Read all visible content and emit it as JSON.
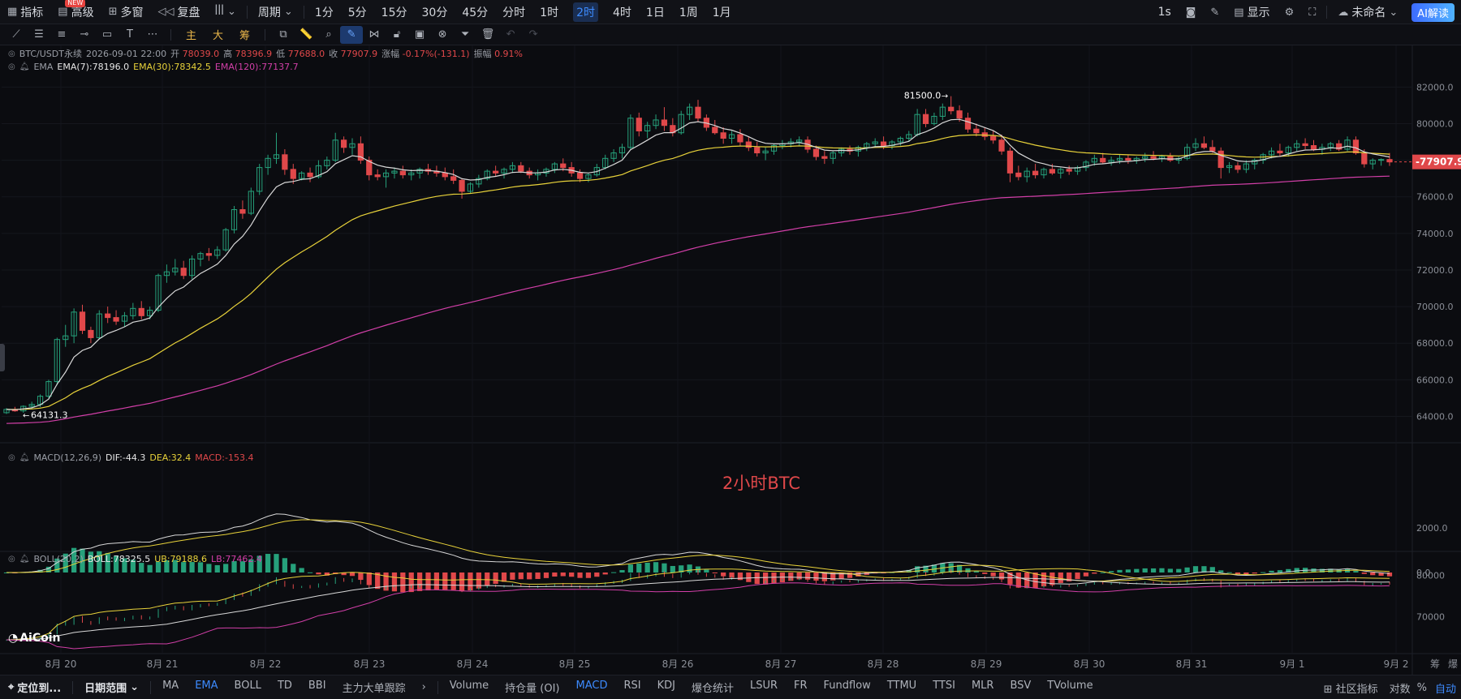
{
  "toolbar": {
    "indicators": "指标",
    "new_badge": "NEW",
    "advanced": "高级",
    "multi_window": "多窗",
    "replay": "复盘",
    "period_label": "周期",
    "intervals": [
      "1分",
      "5分",
      "15分",
      "30分",
      "45分",
      "分时",
      "1时",
      "2时",
      "4时",
      "1日",
      "1周",
      "1月"
    ],
    "active_interval": "2时",
    "refresh": "1s",
    "display": "显示",
    "unnamed": "未命名",
    "ai_read": "AI解读"
  },
  "drawbar": {
    "main": "主",
    "large": "大",
    "chips": "筹"
  },
  "legend": {
    "symbol": "BTC/USDT永续",
    "datetime": "2026-09-01 22:00",
    "open_label": "开",
    "open": "78039.0",
    "high_label": "高",
    "high": "78396.9",
    "low_label": "低",
    "low": "77688.0",
    "close_label": "收",
    "close": "77907.9",
    "change_label": "涨幅",
    "change": "-0.17%(-131.1)",
    "amplitude_label": "振幅",
    "amplitude": "0.91%",
    "ema_name": "EMA",
    "ema7": "EMA(7):78196.0",
    "ema30": "EMA(30):78342.5",
    "ema120": "EMA(120):77137.7",
    "macd_name": "MACD(12,26,9)",
    "dif": "DIF:-44.3",
    "dea": "DEA:32.4",
    "macd": "MACD:-153.4",
    "boll_name": "BOLL(20,2)",
    "boll": "BOLL:78325.5",
    "ub": "UB:79188.6",
    "lb": "LB:77462.4"
  },
  "annotation": "2小时BTC",
  "logo": "AiCoin",
  "colors": {
    "up": "#26a17b",
    "down": "#e0484a",
    "ema7": "#d8d8d8",
    "ema30": "#e8d23a",
    "ema120": "#d23fa8",
    "price_tag": "#e0484a",
    "accent": "#3d8bff"
  },
  "chart_data": {
    "type": "candlestick",
    "symbol": "BTC/USDT永续",
    "interval": "2时",
    "x_ticks": [
      "8月 20",
      "8月 21",
      "8月 22",
      "8月 23",
      "8月 24",
      "8月 25",
      "8月 26",
      "8月 27",
      "8月 28",
      "8月 29",
      "8月 30",
      "8月 31",
      "9月 1",
      "9月 2"
    ],
    "price_axis": {
      "ticks": [
        82000,
        80000,
        78000,
        76000,
        74000,
        72000,
        70000,
        68000,
        66000,
        64000
      ],
      "ylim": [
        63000,
        83300
      ]
    },
    "last_price": 77907.9,
    "high_marker": 81500.0,
    "low_marker": 64131.3,
    "candles_ohlc": [
      [
        64200,
        64450,
        64131.3,
        64380
      ],
      [
        64380,
        64520,
        64250,
        64300
      ],
      [
        64300,
        64600,
        64200,
        64550
      ],
      [
        64550,
        64800,
        64400,
        64650
      ],
      [
        64650,
        65200,
        64500,
        65100
      ],
      [
        65100,
        66000,
        65000,
        65900
      ],
      [
        65900,
        68300,
        65700,
        68200
      ],
      [
        68200,
        69000,
        67800,
        68400
      ],
      [
        68400,
        69900,
        68000,
        69700
      ],
      [
        69700,
        70100,
        68500,
        68700
      ],
      [
        68700,
        68900,
        68000,
        68300
      ],
      [
        68300,
        69800,
        68200,
        69600
      ],
      [
        69600,
        70000,
        69100,
        69400
      ],
      [
        69400,
        69800,
        69000,
        69200
      ],
      [
        69200,
        69700,
        68900,
        69500
      ],
      [
        69500,
        70200,
        69300,
        69900
      ],
      [
        69900,
        70300,
        69300,
        69500
      ],
      [
        69500,
        70000,
        69300,
        69800
      ],
      [
        69800,
        71800,
        69700,
        71700
      ],
      [
        71700,
        72300,
        71300,
        71900
      ],
      [
        71900,
        72600,
        71700,
        72100
      ],
      [
        72100,
        72500,
        71500,
        71700
      ],
      [
        71700,
        72800,
        71500,
        72600
      ],
      [
        72600,
        73000,
        72200,
        72900
      ],
      [
        72900,
        73200,
        72500,
        72800
      ],
      [
        72800,
        73300,
        72600,
        73100
      ],
      [
        73100,
        74300,
        73000,
        74200
      ],
      [
        74200,
        75500,
        74000,
        75300
      ],
      [
        75300,
        75800,
        74800,
        75100
      ],
      [
        75100,
        76500,
        75000,
        76300
      ],
      [
        76300,
        77800,
        76100,
        77600
      ],
      [
        77600,
        78300,
        77200,
        78100
      ],
      [
        78100,
        79500,
        77800,
        78300
      ],
      [
        78300,
        78600,
        77200,
        77500
      ],
      [
        77500,
        77800,
        76700,
        77000
      ],
      [
        77000,
        77400,
        76900,
        77300
      ],
      [
        77300,
        77600,
        76800,
        77100
      ],
      [
        77100,
        78000,
        77000,
        77700
      ],
      [
        77700,
        78200,
        77500,
        78000
      ],
      [
        78000,
        79500,
        77900,
        79100
      ],
      [
        79100,
        79300,
        78400,
        78700
      ],
      [
        78700,
        79200,
        78300,
        78900
      ],
      [
        78900,
        79300,
        77800,
        78000
      ],
      [
        78000,
        78200,
        76900,
        77200
      ],
      [
        77200,
        77500,
        76900,
        77100
      ],
      [
        77100,
        77500,
        76500,
        77300
      ],
      [
        77300,
        77600,
        77000,
        77400
      ],
      [
        77400,
        77700,
        77000,
        77200
      ],
      [
        77200,
        77500,
        76900,
        77300
      ],
      [
        77300,
        77600,
        77000,
        77500
      ],
      [
        77500,
        77800,
        77200,
        77400
      ],
      [
        77400,
        77700,
        77100,
        77300
      ],
      [
        77300,
        77600,
        76900,
        77100
      ],
      [
        77100,
        77500,
        76700,
        76900
      ],
      [
        76900,
        77000,
        75900,
        76300
      ],
      [
        76300,
        76800,
        76200,
        76700
      ],
      [
        76700,
        77200,
        76500,
        77000
      ],
      [
        77000,
        77500,
        76900,
        77400
      ],
      [
        77400,
        77700,
        77100,
        77300
      ],
      [
        77300,
        77600,
        77000,
        77500
      ],
      [
        77500,
        77900,
        77300,
        77700
      ],
      [
        77700,
        77900,
        77300,
        77400
      ],
      [
        77400,
        77600,
        77000,
        77200
      ],
      [
        77200,
        77500,
        76900,
        77300
      ],
      [
        77300,
        77600,
        77100,
        77500
      ],
      [
        77500,
        77900,
        77300,
        77800
      ],
      [
        77800,
        78100,
        77400,
        77600
      ],
      [
        77600,
        77900,
        77100,
        77300
      ],
      [
        77300,
        77500,
        76800,
        77000
      ],
      [
        77000,
        77300,
        76800,
        77200
      ],
      [
        77200,
        77800,
        77100,
        77600
      ],
      [
        77600,
        78300,
        77500,
        78100
      ],
      [
        78100,
        78600,
        77900,
        78400
      ],
      [
        78400,
        78900,
        78100,
        78700
      ],
      [
        78700,
        80500,
        78600,
        80300
      ],
      [
        80300,
        80600,
        79300,
        79600
      ],
      [
        79600,
        80100,
        79200,
        79900
      ],
      [
        79900,
        80500,
        79700,
        80200
      ],
      [
        80200,
        80900,
        79600,
        79900
      ],
      [
        79900,
        80300,
        79300,
        79500
      ],
      [
        79500,
        80700,
        79400,
        80500
      ],
      [
        80500,
        81100,
        80200,
        80900
      ],
      [
        80900,
        81300,
        80100,
        80300
      ],
      [
        80300,
        80500,
        79600,
        79800
      ],
      [
        79800,
        80200,
        79400,
        79500
      ],
      [
        79500,
        79800,
        78900,
        79200
      ],
      [
        79200,
        79600,
        78900,
        79400
      ],
      [
        79400,
        79700,
        78800,
        79000
      ],
      [
        79000,
        79300,
        78500,
        78700
      ],
      [
        78700,
        79000,
        78200,
        78400
      ],
      [
        78400,
        78700,
        78000,
        78500
      ],
      [
        78500,
        78900,
        78300,
        78800
      ],
      [
        78800,
        79100,
        78600,
        78900
      ],
      [
        78900,
        79200,
        78700,
        79000
      ],
      [
        79000,
        79300,
        78800,
        79100
      ],
      [
        79100,
        79300,
        78400,
        78600
      ],
      [
        78600,
        78800,
        78000,
        78200
      ],
      [
        78200,
        78500,
        77800,
        78100
      ],
      [
        78100,
        78500,
        77800,
        78400
      ],
      [
        78400,
        78700,
        78200,
        78600
      ],
      [
        78600,
        78800,
        78300,
        78500
      ],
      [
        78500,
        78800,
        78200,
        78700
      ],
      [
        78700,
        79000,
        78500,
        78900
      ],
      [
        78900,
        79200,
        78700,
        79000
      ],
      [
        79000,
        79300,
        78600,
        78800
      ],
      [
        78800,
        79100,
        78600,
        79000
      ],
      [
        79000,
        79300,
        78800,
        79200
      ],
      [
        79200,
        79600,
        79000,
        79400
      ],
      [
        79400,
        80800,
        79300,
        80500
      ],
      [
        80500,
        80800,
        79800,
        80000
      ],
      [
        80000,
        80600,
        79900,
        80400
      ],
      [
        80400,
        81100,
        80200,
        80900
      ],
      [
        80900,
        81500,
        80500,
        80700
      ],
      [
        80700,
        81000,
        80100,
        80300
      ],
      [
        80300,
        80600,
        79500,
        79700
      ],
      [
        79700,
        80000,
        79300,
        79500
      ],
      [
        79500,
        79800,
        79100,
        79300
      ],
      [
        79300,
        79600,
        78900,
        79100
      ],
      [
        79100,
        79400,
        78300,
        78500
      ],
      [
        78500,
        78700,
        76800,
        77300
      ],
      [
        77300,
        77700,
        76900,
        77100
      ],
      [
        77100,
        77600,
        76800,
        77400
      ],
      [
        77400,
        77800,
        77000,
        77200
      ],
      [
        77200,
        77600,
        77000,
        77500
      ],
      [
        77500,
        77800,
        77200,
        77300
      ],
      [
        77300,
        77600,
        77000,
        77500
      ],
      [
        77500,
        77700,
        77200,
        77400
      ],
      [
        77400,
        77700,
        77200,
        77600
      ],
      [
        77600,
        78000,
        77400,
        77900
      ],
      [
        77900,
        78300,
        77700,
        78100
      ],
      [
        78100,
        78400,
        77800,
        77900
      ],
      [
        77900,
        78200,
        77700,
        78000
      ],
      [
        78000,
        78300,
        77800,
        78100
      ],
      [
        78100,
        78300,
        77800,
        78000
      ],
      [
        78000,
        78200,
        77800,
        78100
      ],
      [
        78100,
        78400,
        77900,
        78200
      ],
      [
        78200,
        78500,
        78000,
        78100
      ],
      [
        78100,
        78300,
        77900,
        78200
      ],
      [
        78200,
        78400,
        77900,
        78000
      ],
      [
        78000,
        78200,
        77800,
        78100
      ],
      [
        78100,
        78900,
        78000,
        78700
      ],
      [
        78700,
        79200,
        78500,
        78900
      ],
      [
        78900,
        79300,
        78600,
        78700
      ],
      [
        78700,
        79100,
        78400,
        78500
      ],
      [
        78500,
        78700,
        77000,
        77600
      ],
      [
        77600,
        77900,
        77300,
        77700
      ],
      [
        77700,
        77900,
        77300,
        77500
      ],
      [
        77500,
        78000,
        77300,
        77800
      ],
      [
        77800,
        78100,
        77500,
        78000
      ],
      [
        78000,
        78400,
        77800,
        78300
      ],
      [
        78300,
        78700,
        78100,
        78500
      ],
      [
        78500,
        78900,
        78200,
        78400
      ],
      [
        78400,
        78800,
        78200,
        78700
      ],
      [
        78700,
        79100,
        78500,
        78900
      ],
      [
        78900,
        79200,
        78600,
        78800
      ],
      [
        78800,
        79100,
        78500,
        78600
      ],
      [
        78600,
        78900,
        78300,
        78700
      ],
      [
        78700,
        79000,
        78500,
        78900
      ],
      [
        78900,
        79100,
        78500,
        78600
      ],
      [
        78600,
        79300,
        78500,
        79100
      ],
      [
        79100,
        79300,
        78300,
        78400
      ],
      [
        78400,
        78600,
        77600,
        77800
      ],
      [
        77800,
        78100,
        77500,
        78000
      ],
      [
        78000,
        78100,
        77700,
        78039
      ],
      [
        78039,
        78396.9,
        77688,
        77907.9
      ]
    ],
    "macd": {
      "axis_ticks": [
        2000.0,
        0.0
      ]
    },
    "boll": {
      "axis_ticks": [
        80000,
        70000
      ]
    }
  }
}
